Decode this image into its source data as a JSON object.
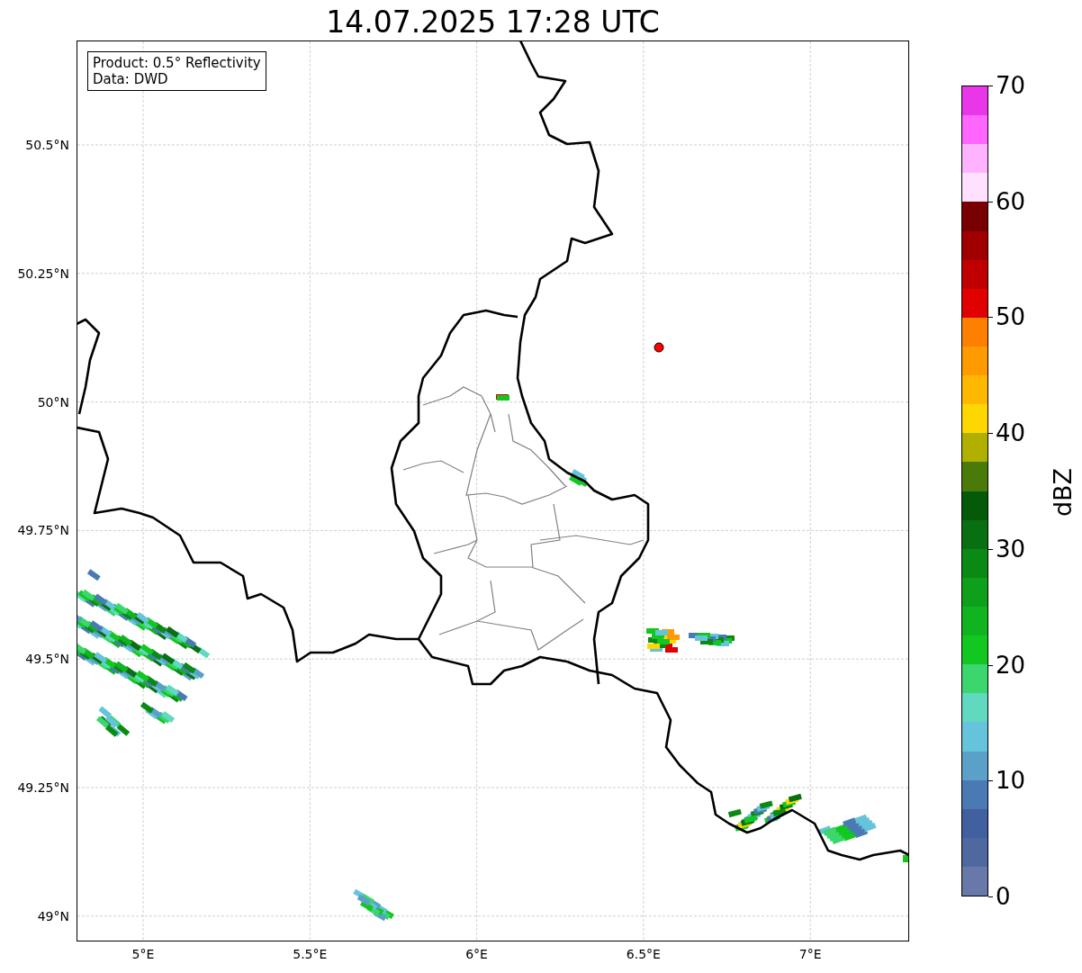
{
  "title": "14.07.2025 17:28 UTC",
  "map": {
    "legend": [
      "Product: 0.5° Reflectivity",
      "Data: DWD"
    ],
    "xticks": [
      "5°E",
      "5.5°E",
      "6°E",
      "6.5°E",
      "7°E"
    ],
    "yticks": [
      "50.5°N",
      "50.25°N",
      "50°N",
      "49.75°N",
      "49.5°N",
      "49.25°N",
      "49°N"
    ]
  },
  "colorbar": {
    "label": "dBZ",
    "ticks": [
      "70",
      "60",
      "50",
      "40",
      "30",
      "20",
      "10",
      "0"
    ],
    "segments": [
      {
        "color": "#e836e8"
      },
      {
        "color": "#ff66ff"
      },
      {
        "color": "#ffb3ff"
      },
      {
        "color": "#ffe0ff"
      },
      {
        "color": "#780000"
      },
      {
        "color": "#a00000"
      },
      {
        "color": "#c00000"
      },
      {
        "color": "#e00000"
      },
      {
        "color": "#ff8000"
      },
      {
        "color": "#ff9a00"
      },
      {
        "color": "#ffb800"
      },
      {
        "color": "#ffd700"
      },
      {
        "color": "#b0b000"
      },
      {
        "color": "#4a7a0a"
      },
      {
        "color": "#055a0a"
      },
      {
        "color": "#087010"
      },
      {
        "color": "#0a8a14"
      },
      {
        "color": "#0ea01a"
      },
      {
        "color": "#10b41e"
      },
      {
        "color": "#12c820"
      },
      {
        "color": "#3cd66e"
      },
      {
        "color": "#60d9c0"
      },
      {
        "color": "#66c3dc"
      },
      {
        "color": "#5aa0c8"
      },
      {
        "color": "#4a7ab4"
      },
      {
        "color": "#4060a0"
      },
      {
        "color": "#5068a0"
      },
      {
        "color": "#6878a8"
      }
    ]
  }
}
